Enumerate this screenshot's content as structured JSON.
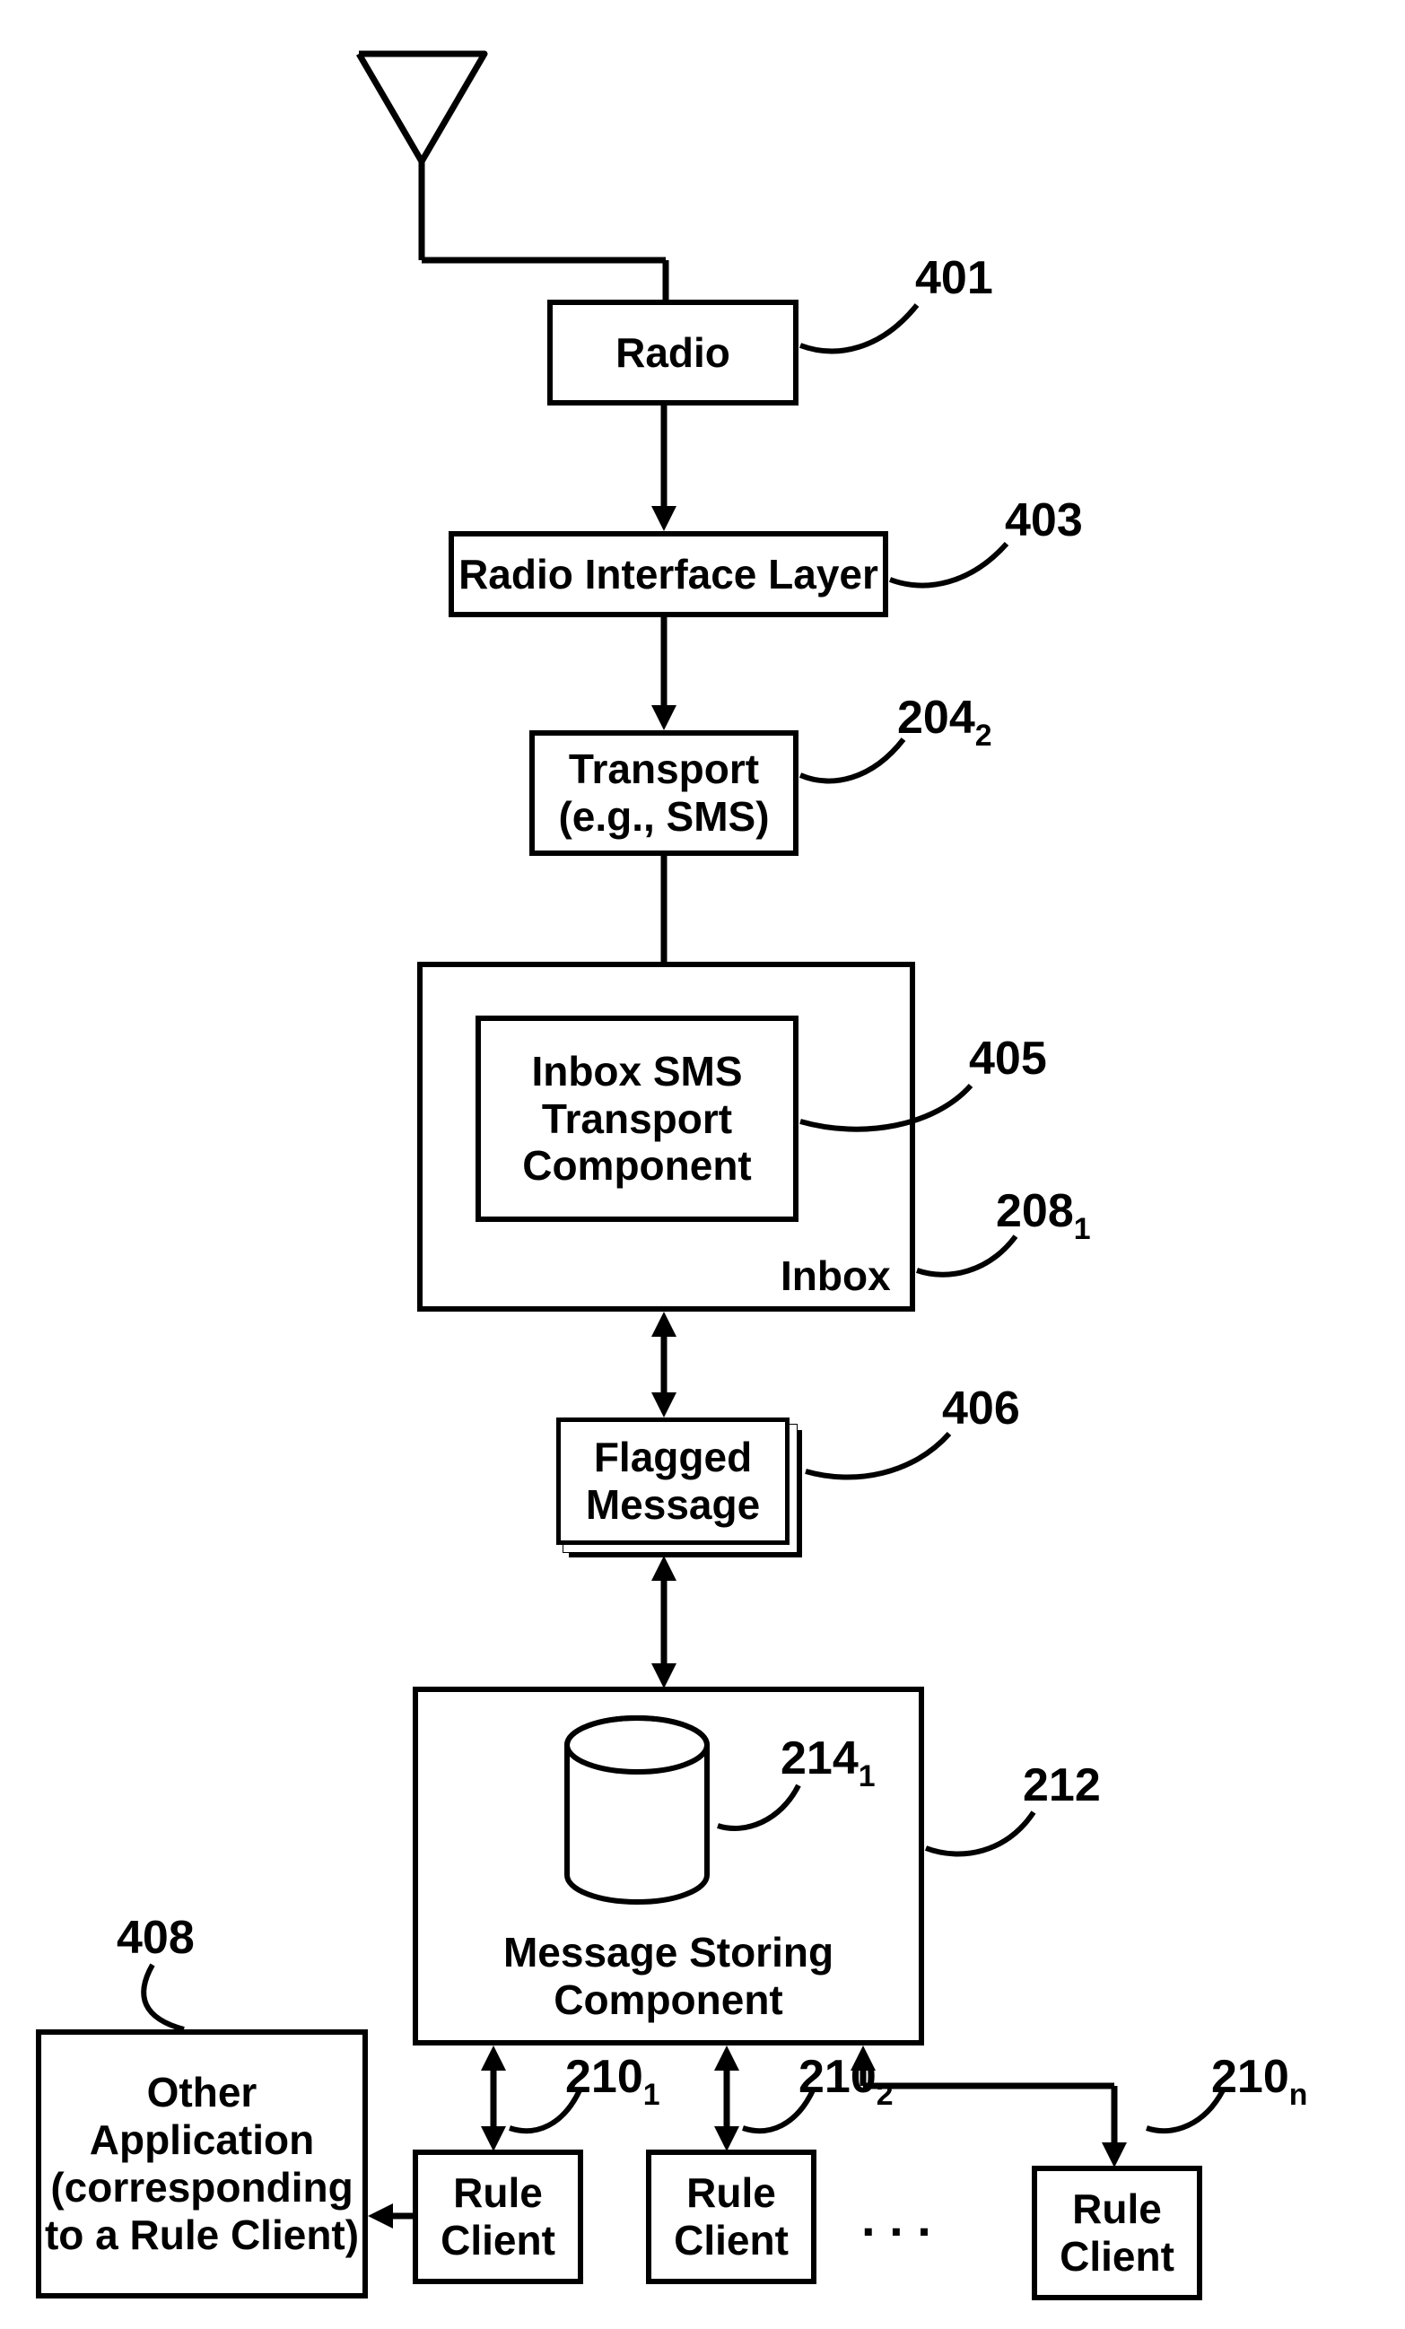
{
  "boxes": {
    "radio": "Radio",
    "ril": "Radio Interface Layer",
    "transport_line1": "Transport",
    "transport_line2": "(e.g., SMS)",
    "inbox_sms_l1": "Inbox SMS",
    "inbox_sms_l2": "Transport",
    "inbox_sms_l3": "Component",
    "inbox_label": "Inbox",
    "flagged_l1": "Flagged",
    "flagged_l2": "Message",
    "msc_l1": "Message Storing",
    "msc_l2": "Component",
    "rule_l1": "Rule",
    "rule_l2": "Client",
    "other_l1": "Other",
    "other_l2": "Application",
    "other_l3": "(corresponding",
    "other_l4": "to a Rule Client)"
  },
  "refs": {
    "r401": "401",
    "r403": "403",
    "r2042_main": "204",
    "r2042_sub": "2",
    "r405": "405",
    "r2081_main": "208",
    "r2081_sub": "1",
    "r406": "406",
    "r2141_main": "214",
    "r2141_sub": "1",
    "r212": "212",
    "r408": "408",
    "r2101_main": "210",
    "r2101_sub": "1",
    "r2102_main": "210",
    "r2102_sub": "2",
    "r210n_main": "210",
    "r210n_sub": "n"
  },
  "misc": {
    "ellipsis": ". . ."
  }
}
